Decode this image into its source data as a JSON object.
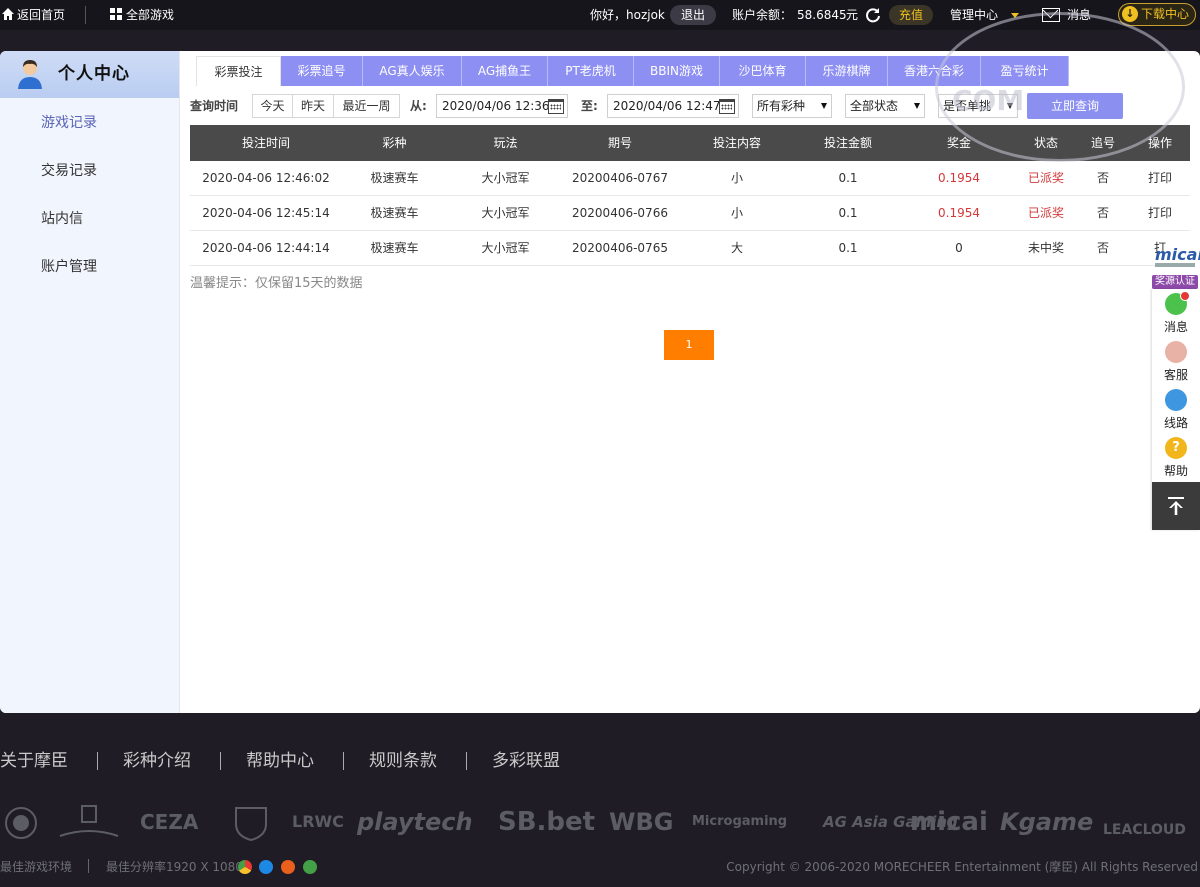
{
  "topbar": {
    "home_label": "返回首页",
    "games_label": "全部游戏",
    "greeting": "你好，hozjok",
    "logout_label": "退出",
    "balance_label": "账户余额：",
    "balance_value": "58.6845",
    "currency": "元",
    "recharge_label": "充值",
    "manage_label": "管理中心",
    "message_label": "消息",
    "download_label": "下载中心"
  },
  "sidebar": {
    "title": "个人中心",
    "items": [
      {
        "label": "游戏记录",
        "active": true
      },
      {
        "label": "交易记录",
        "active": false
      },
      {
        "label": "站内信",
        "active": false
      },
      {
        "label": "账户管理",
        "active": false
      }
    ]
  },
  "tabs": [
    {
      "label": "彩票投注",
      "active": true
    },
    {
      "label": "彩票追号",
      "active": false
    },
    {
      "label": "AG真人娱乐",
      "active": false
    },
    {
      "label": "AG捕鱼王",
      "active": false
    },
    {
      "label": "PT老虎机",
      "active": false
    },
    {
      "label": "BBIN游戏",
      "active": false
    },
    {
      "label": "沙巴体育",
      "active": false
    },
    {
      "label": "乐游棋牌",
      "active": false
    },
    {
      "label": "香港六合彩",
      "active": false
    },
    {
      "label": "盈亏统计",
      "active": false
    }
  ],
  "filter": {
    "query_time_label": "查询时间",
    "quick_ranges": [
      "今天",
      "昨天",
      "最近一周"
    ],
    "from_label": "从:",
    "from_value": "2020/04/06 12:36",
    "to_label": "至:",
    "to_value": "2020/04/06 12:47",
    "lottery_select": "所有彩种",
    "status_select": "全部状态",
    "single_select": "是否单挑",
    "query_button": "立即查询"
  },
  "table": {
    "headers": [
      "投注时间",
      "彩种",
      "玩法",
      "期号",
      "投注内容",
      "投注金额",
      "奖金",
      "状态",
      "追号",
      "操作"
    ],
    "rows": [
      [
        "2020-04-06 12:46:02",
        "极速赛车",
        "大小冠军",
        "20200406-0767",
        "小",
        "0.1",
        "0.1954",
        "已派奖",
        "否",
        "打印"
      ],
      [
        "2020-04-06 12:45:14",
        "极速赛车",
        "大小冠军",
        "20200406-0766",
        "小",
        "0.1",
        "0.1954",
        "已派奖",
        "否",
        "打印"
      ],
      [
        "2020-04-06 12:44:14",
        "极速赛车",
        "大小冠军",
        "20200406-0765",
        "大",
        "0.1",
        "0",
        "未中奖",
        "否",
        "打"
      ]
    ]
  },
  "tip": "温馨提示：仅保留15天的数据",
  "pagination": {
    "current": "1"
  },
  "right_bar": {
    "micai_logo": "micai",
    "badge": "奖源认证",
    "items": [
      {
        "label": "消息",
        "icon": "chat-icon",
        "color": "#4cc24c"
      },
      {
        "label": "客服",
        "icon": "service-girl-icon",
        "color": "#e8b1a6"
      },
      {
        "label": "线路",
        "icon": "speedometer-icon",
        "color": "#3f96e0"
      },
      {
        "label": "帮助",
        "icon": "help-icon",
        "color": "#f2b51c"
      }
    ]
  },
  "footer": {
    "links": [
      "关于摩臣",
      "彩种介绍",
      "帮助中心",
      "规则条款",
      "多彩联盟"
    ],
    "logos": [
      "CEZA",
      "LRWC",
      "playtech",
      "SB.bet",
      "WBG",
      "Microgaming",
      "AG Asia Gaming",
      "micai",
      "Kgame",
      "LEACLOUD"
    ],
    "env_label": "最佳游戏环境",
    "resolution_label": "最佳分辨率1920 X 1080",
    "copyright": "Copyright © 2006-2020 MORECHEER Entertainment (摩臣) All Rights Reserved"
  },
  "watermark": "COM"
}
